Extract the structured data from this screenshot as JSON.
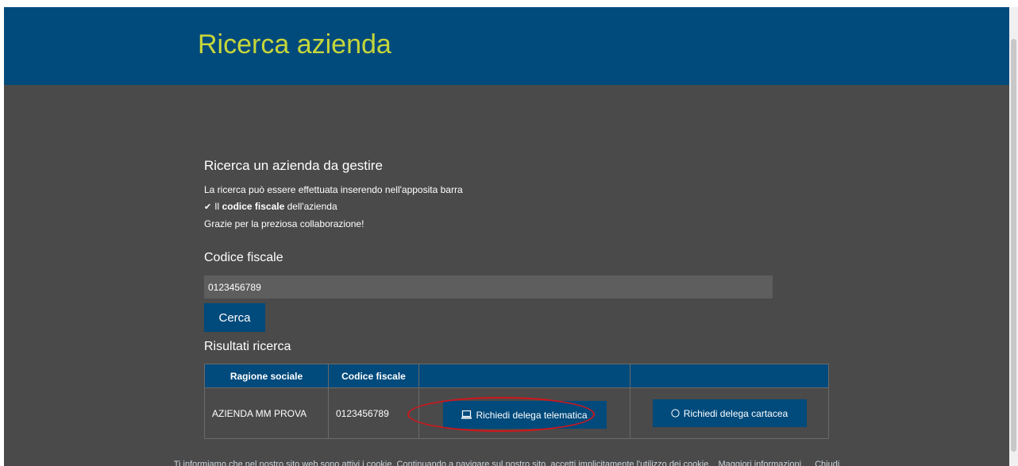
{
  "header": {
    "title": "Ricerca azienda",
    "bg_color": "#004a7c",
    "title_color": "#c6d63a"
  },
  "search": {
    "section_title": "Ricerca un azienda da gestire",
    "info_line1": "La ricerca può essere effettuata inserendo nell'apposita barra",
    "check_icon": "check-icon",
    "info_line2_prefix": "Il ",
    "info_line2_bold": "codice fiscale",
    "info_line2_suffix": " dell'azienda",
    "info_line3": "Grazie per la preziosa collaborazione!",
    "field_label": "Codice fiscale",
    "field_value": "0123456789",
    "button_label": "Cerca"
  },
  "results": {
    "title": "Risultati ricerca",
    "columns": [
      "Ragione sociale",
      "Codice fiscale",
      "",
      ""
    ],
    "rows": [
      {
        "ragione_sociale": "AZIENDA MM PROVA",
        "codice_fiscale": "0123456789",
        "telematica_label": "Richiedi delega telematica",
        "telematica_icon": "laptop-icon",
        "cartacea_label": "Richiedi delega cartacea",
        "cartacea_icon": "circle-icon"
      }
    ]
  },
  "cookie_bar": {
    "text": "Ti informiamo che nel nostro sito web sono attivi i cookie. Continuando a navigare sul nostro sito, accetti implicitamente l'utilizzo dei cookie.",
    "more_link": "Maggiori informazioni",
    "close_link": "Chiudi"
  },
  "colors": {
    "page_bg": "#4a4a4a",
    "accent": "#004a7c",
    "highlight": "#d0161c"
  }
}
